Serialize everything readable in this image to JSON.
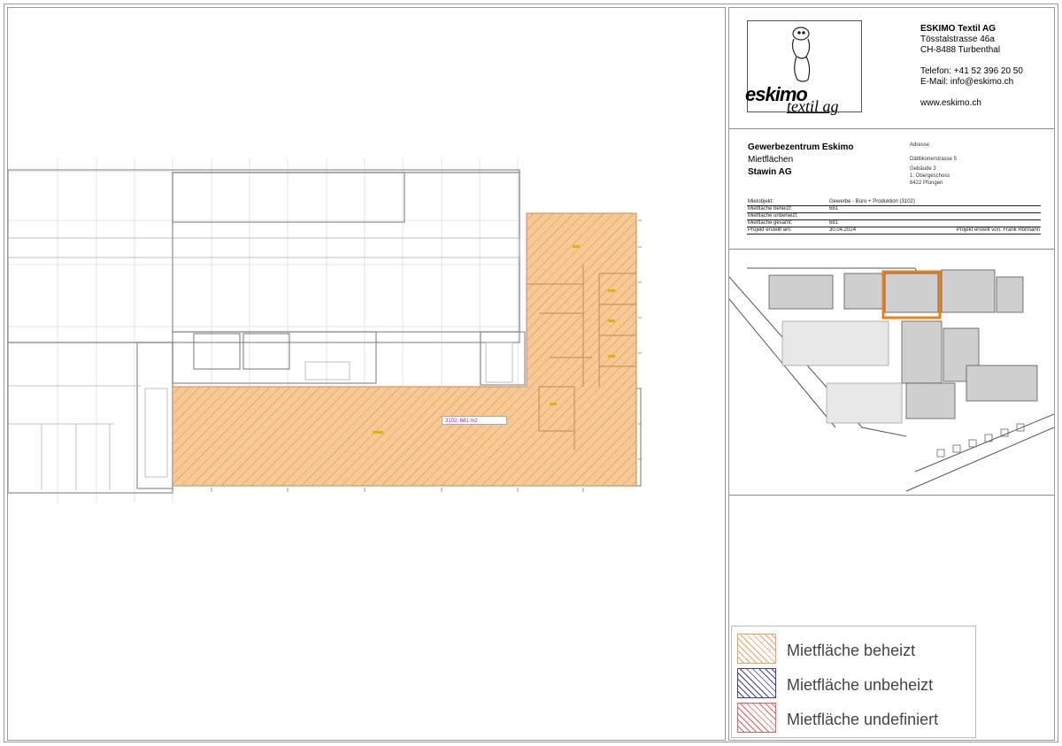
{
  "company": {
    "name": "ESKIMO Textil AG",
    "street": "Tösstalstrasse 46a",
    "city": "CH-8488 Turbenthal",
    "phone": "Telefon: +41 52 396 20 50",
    "email": "E-Mail: info@eskimo.ch",
    "web": "www.eskimo.ch",
    "logo_text": "eskimo",
    "logo_sub": "textil ag"
  },
  "project": {
    "title": "Gewerbezentrum Eskimo",
    "subtitle": "Mietflächen",
    "tenant": "Stawin AG"
  },
  "address": {
    "heading": "Adresse",
    "street": "Dättlikonerstrasse 5",
    "building": "Gebäude 3",
    "floor": "1. Obergeschoss",
    "city": "8422 Pfungen"
  },
  "info_rows": [
    {
      "label": "Mietobjekt:",
      "value": "Gewerbe - Büro + Produktion (3102)",
      "extra": ""
    },
    {
      "label": "Mietfläche beheizt:",
      "value": "681",
      "extra": ""
    },
    {
      "label": "Mietfläche unbeheizt:",
      "value": "",
      "extra": ""
    },
    {
      "label": "Mietfläche gesamt:",
      "value": "681",
      "extra": ""
    },
    {
      "label": "Projekt erstellt am:",
      "value": "30.04.2024",
      "extra": "Projekt erstellt von: Frank Hörmann"
    }
  ],
  "plan": {
    "area_label": "3102: 681 m2"
  },
  "legend": [
    {
      "label": "Mietfläche beheizt",
      "color": "#e8a060"
    },
    {
      "label": "Mietfläche unbeheizt",
      "color": "#3a3ab8"
    },
    {
      "label": "Mietfläche undefiniert",
      "color": "#e06060"
    }
  ],
  "colors": {
    "rented_fill": "#f6c995",
    "rented_hatch": "#d9894a",
    "site_highlight": "#f07f10"
  }
}
